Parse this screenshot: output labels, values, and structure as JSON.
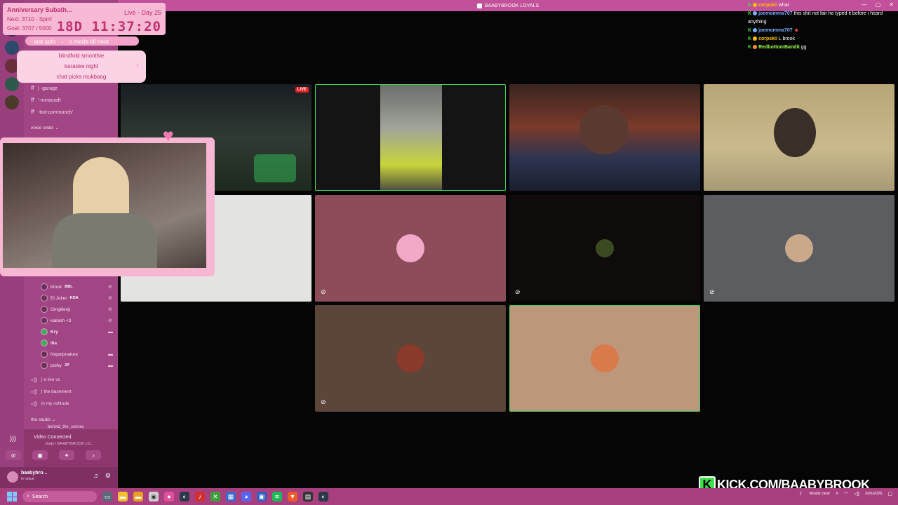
{
  "window": {
    "title": "BAABYBROOK LOYALS",
    "controls": [
      "—",
      "▢",
      "✕"
    ]
  },
  "subathon": {
    "title": "Anniversary Subath...",
    "next": "Next: 3710 - Spin!",
    "goal": "Goal: 3707 / 5000",
    "day": "Live - Day 25",
    "timer": "18D 11:37:20"
  },
  "spin": {
    "last_spin": "last spin",
    "mods": "o mods till next",
    "items": [
      "blindfold smoothie",
      "karaoke night",
      "chat picks mukbang"
    ]
  },
  "channels": {
    "text": [
      "| -garage",
      "'-minecraft",
      "-bot-commands'"
    ],
    "category": "voice chats",
    "voice_users": [
      {
        "name": "brook",
        "badge": "BBL"
      },
      {
        "name": "El Joker",
        "badge": "KOA"
      },
      {
        "name": "Gingillenji",
        "badge": ""
      },
      {
        "name": "kailash <3",
        "badge": ""
      },
      {
        "name": "Kry",
        "badge": ""
      },
      {
        "name": "lila",
        "badge": ""
      },
      {
        "name": "Nopulpnature",
        "badge": ""
      },
      {
        "name": "porky",
        "badge": "JP"
      }
    ],
    "voice_channels": [
      "| e live vc",
      "| the basement",
      "in my solitude"
    ],
    "studio_category": "the studio",
    "studio_sub": "behind_the_scenes"
  },
  "voice_panel": {
    "status": "Video Connected",
    "channel": "chats / BAABYBROOK LO..."
  },
  "user": {
    "name": "baabybro...",
    "status": "In voice"
  },
  "tiles": {
    "live": "LIVE"
  },
  "chat": [
    {
      "user": "corpskii",
      "color": "#ffc000",
      "msg": "what"
    },
    {
      "user": "joemomma707",
      "color": "#7ab0ff",
      "msg": "this shit not fair he typed it before i heard anything"
    },
    {
      "user": "joemomma707",
      "color": "#7ab0ff",
      "msg": ""
    },
    {
      "user": "corpskii",
      "color": "#ffc000",
      "msg": "L brook"
    },
    {
      "user": "RedbottomBandit",
      "color": "#9eff4a",
      "msg": "gg"
    }
  ],
  "kick": {
    "k": "K",
    "url": "KICK.COM/BAABYBROOK"
  },
  "taskbar": {
    "search": "Search",
    "weather": "Mostly clear",
    "time": "2/26/2026"
  },
  "icons": [
    "windows-icon",
    "search-icon",
    "speaker-icon",
    "mic-off-icon",
    "camera-icon",
    "gear-icon",
    "headphones-icon"
  ]
}
